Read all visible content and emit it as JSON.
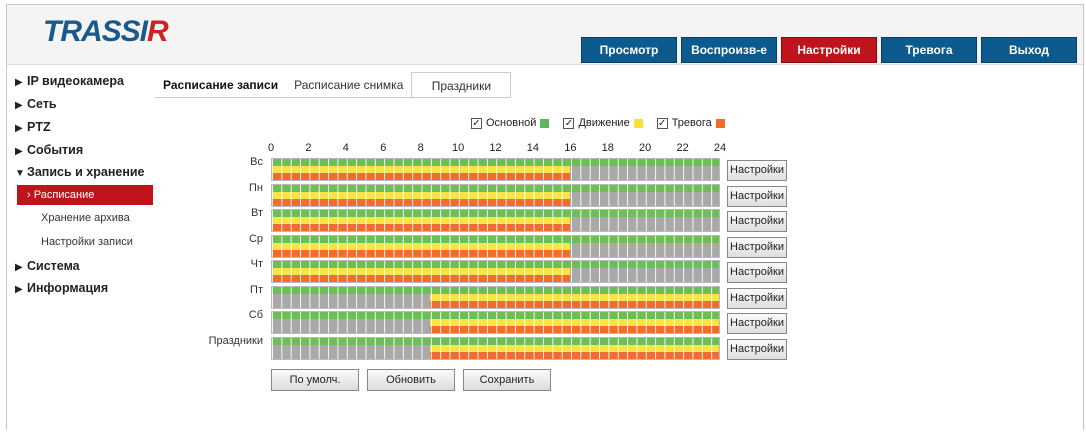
{
  "brand": {
    "logo_main": "TRASSI",
    "logo_r": "R"
  },
  "nav": [
    {
      "label": "Просмотр",
      "active": false
    },
    {
      "label": "Воспроизв-е",
      "active": false
    },
    {
      "label": "Настройки",
      "active": true
    },
    {
      "label": "Тревога",
      "active": false
    },
    {
      "label": "Выход",
      "active": false
    }
  ],
  "sidebar": {
    "items": [
      {
        "label": "IP видеокамера",
        "expanded": false
      },
      {
        "label": "Сеть",
        "expanded": false
      },
      {
        "label": "PTZ",
        "expanded": false
      },
      {
        "label": "События",
        "expanded": false
      },
      {
        "label": "Запись и хранение",
        "expanded": true
      },
      {
        "label": "Система",
        "expanded": false
      },
      {
        "label": "Информация",
        "expanded": false
      }
    ],
    "subitems": [
      {
        "label": "Расписание",
        "active": true
      },
      {
        "label": "Хранение архива",
        "active": false
      },
      {
        "label": "Настройки записи",
        "active": false
      }
    ],
    "tri_right": "▶",
    "tri_down": "▼",
    "active_prefix": "›"
  },
  "subtabs": [
    {
      "label": "Расписание записи",
      "active": true
    },
    {
      "label": "Расписание снимка",
      "active": false
    },
    {
      "label": "Праздники",
      "active": false
    }
  ],
  "legend": [
    {
      "label": "Основной",
      "checked": true,
      "color": "#5cb85c"
    },
    {
      "label": "Движение",
      "checked": true,
      "color": "#f5e33a"
    },
    {
      "label": "Тревога",
      "checked": true,
      "color": "#f26b2a"
    }
  ],
  "check_mark": "✓",
  "scale": [
    "0",
    "2",
    "4",
    "6",
    "8",
    "10",
    "12",
    "14",
    "16",
    "18",
    "20",
    "22",
    "24"
  ],
  "colors": {
    "main": "#6cbf55",
    "motion": "#f7e544",
    "alarm": "#f36b2e",
    "empty": "#a9a9a9"
  },
  "schedule": [
    {
      "day": "Вс",
      "main": [
        0,
        24
      ],
      "motion": [
        0,
        16
      ],
      "alarm": [
        0,
        16
      ]
    },
    {
      "day": "Пн",
      "main": [
        0,
        24
      ],
      "motion": [
        0,
        16
      ],
      "alarm": [
        0,
        16
      ]
    },
    {
      "day": "Вт",
      "main": [
        0,
        24
      ],
      "motion": [
        0,
        16
      ],
      "alarm": [
        0,
        16
      ]
    },
    {
      "day": "Ср",
      "main": [
        0,
        24
      ],
      "motion": [
        0,
        16
      ],
      "alarm": [
        0,
        16
      ]
    },
    {
      "day": "Чт",
      "main": [
        0,
        24
      ],
      "motion": [
        0,
        16
      ],
      "alarm": [
        0,
        16
      ]
    },
    {
      "day": "Пт",
      "main": [
        0,
        24
      ],
      "motion": [
        8.5,
        24
      ],
      "alarm": [
        8.5,
        24
      ]
    },
    {
      "day": "Сб",
      "main": [
        0,
        24
      ],
      "motion": [
        8.5,
        24
      ],
      "alarm": [
        8.5,
        24
      ]
    },
    {
      "day": "Праздники",
      "main": [
        0,
        24
      ],
      "motion": [
        8.5,
        24
      ],
      "alarm": [
        8.5,
        24
      ]
    }
  ],
  "row_button_label": "Настройки",
  "actions": {
    "default_label": "По умолч.",
    "refresh_label": "Обновить",
    "save_label": "Сохранить"
  }
}
